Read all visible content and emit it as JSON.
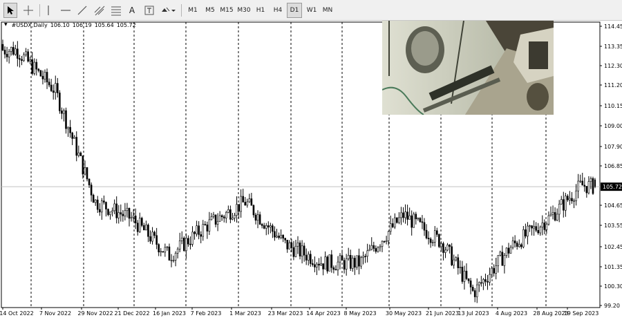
{
  "toolbar": {
    "timeframes": [
      "M1",
      "M5",
      "M15",
      "M30",
      "H1",
      "H4",
      "D1",
      "W1",
      "MN"
    ],
    "active_timeframe": "D1",
    "text_tool": "A"
  },
  "legend": {
    "symbol": "#USDX,Daily",
    "open": "106.10",
    "high": "106.19",
    "low": "105.64",
    "close": "105.72"
  },
  "price_scale": {
    "labels": [
      "114.45",
      "113.35",
      "112.30",
      "111.20",
      "110.15",
      "109.00",
      "107.90",
      "106.85",
      "104.65",
      "103.55",
      "102.45",
      "101.35",
      "100.30",
      "99.20"
    ],
    "current_price": "105.72"
  },
  "time_axis": {
    "labels": [
      "14 Oct 2022",
      "7 Nov 2022",
      "29 Nov 2022",
      "21 Dec 2022",
      "16 Jan 2023",
      "7 Feb 2023",
      "1 Mar 2023",
      "23 Mar 2023",
      "14 Apr 2023",
      "8 May 2023",
      "30 May 2023",
      "21 Jun 2023",
      "13 Jul 2023",
      "4 Aug 2023",
      "28 Aug 2023",
      "19 Sep 2023"
    ]
  },
  "colors": {
    "candle": "#000000",
    "grid": "#000000",
    "price_line": "#c0c0c0",
    "current_price_bg": "#000000",
    "current_price_text": "#ffffff"
  },
  "chart_data": {
    "type": "candlestick",
    "symbol": "#USDX",
    "timeframe": "Daily",
    "ylim": [
      99.2,
      114.6
    ],
    "x": [
      "14 Oct 2022",
      "7 Nov 2022",
      "29 Nov 2022",
      "21 Dec 2022",
      "16 Jan 2023",
      "7 Feb 2023",
      "1 Mar 2023",
      "23 Mar 2023",
      "14 Apr 2023",
      "8 May 2023",
      "30 May 2023",
      "21 Jun 2023",
      "13 Jul 2023",
      "4 Aug 2023",
      "28 Aug 2023",
      "19 Sep 2023",
      "end"
    ],
    "close": [
      113.1,
      110.9,
      104.9,
      104.0,
      102.0,
      103.6,
      104.9,
      102.6,
      101.6,
      101.6,
      104.2,
      102.7,
      100.0,
      102.5,
      104.1,
      105.8,
      105.72
    ],
    "last": {
      "open": 106.1,
      "high": 106.19,
      "low": 105.64,
      "close": 105.72
    },
    "grid": true
  }
}
